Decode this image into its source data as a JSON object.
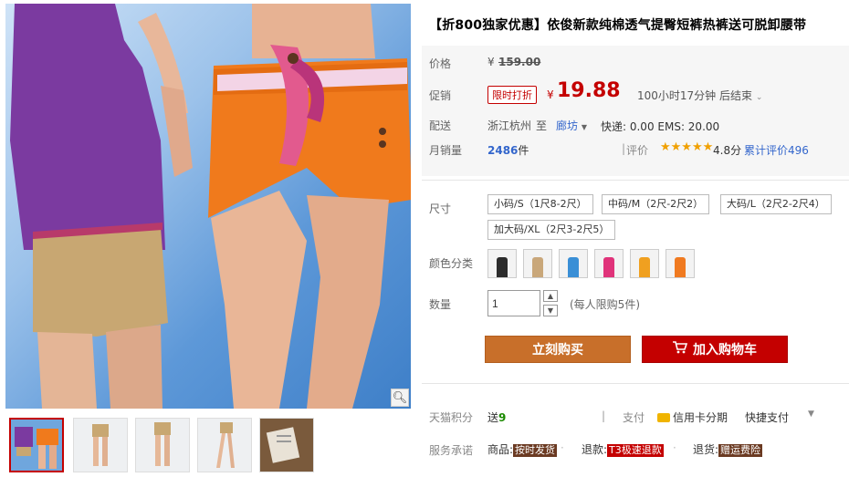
{
  "product": {
    "title": "【折800独家优惠】依俊新款纯棉透气提臀短裤热裤送可脱卸腰带"
  },
  "price": {
    "label": "价格",
    "currency": "¥",
    "original": "159.00"
  },
  "promo": {
    "label": "促销",
    "badge": "限时打折",
    "currency": "¥",
    "price": "19.88",
    "countdown": "100小时17分钟 后结束"
  },
  "shipping": {
    "label": "配送",
    "from": "浙江杭州",
    "to_word": "至",
    "to": "廊坊",
    "fees": "快递: 0.00 EMS: 20.00"
  },
  "sales": {
    "label": "月销量",
    "count": "2486",
    "unit": "件",
    "rating_label": "评价",
    "stars": "★★★★★",
    "score": "4.8分",
    "reviews": "累计评价496"
  },
  "size": {
    "label": "尺寸",
    "options": [
      "小码/S（1尺8-2尺）",
      "中码/M（2尺-2尺2）",
      "大码/L（2尺2-2尺4）",
      "加大码/XL（2尺3-2尺5）"
    ]
  },
  "color": {
    "label": "颜色分类",
    "colors": [
      "#2b2b2b",
      "#c9a77a",
      "#3a8fd6",
      "#e0337a",
      "#f0a020",
      "#f07a20"
    ]
  },
  "quantity": {
    "label": "数量",
    "value": "1",
    "limit": "(每人限购5件)"
  },
  "actions": {
    "buy": "立刻购买",
    "cart": "加入购物车"
  },
  "points": {
    "label": "天猫积分",
    "send": "送",
    "amount": "9",
    "pay_label": "支付",
    "credit": "信用卡分期",
    "quick": "快捷支付"
  },
  "service": {
    "label": "服务承诺",
    "goods": "商品:",
    "goods_tag": "按时发货",
    "refund": "退款:",
    "refund_tag": "T3极速退款",
    "return": "退货:",
    "return_tag": "赠运费险"
  },
  "gallery": {
    "zoom_icon": "search-icon"
  }
}
